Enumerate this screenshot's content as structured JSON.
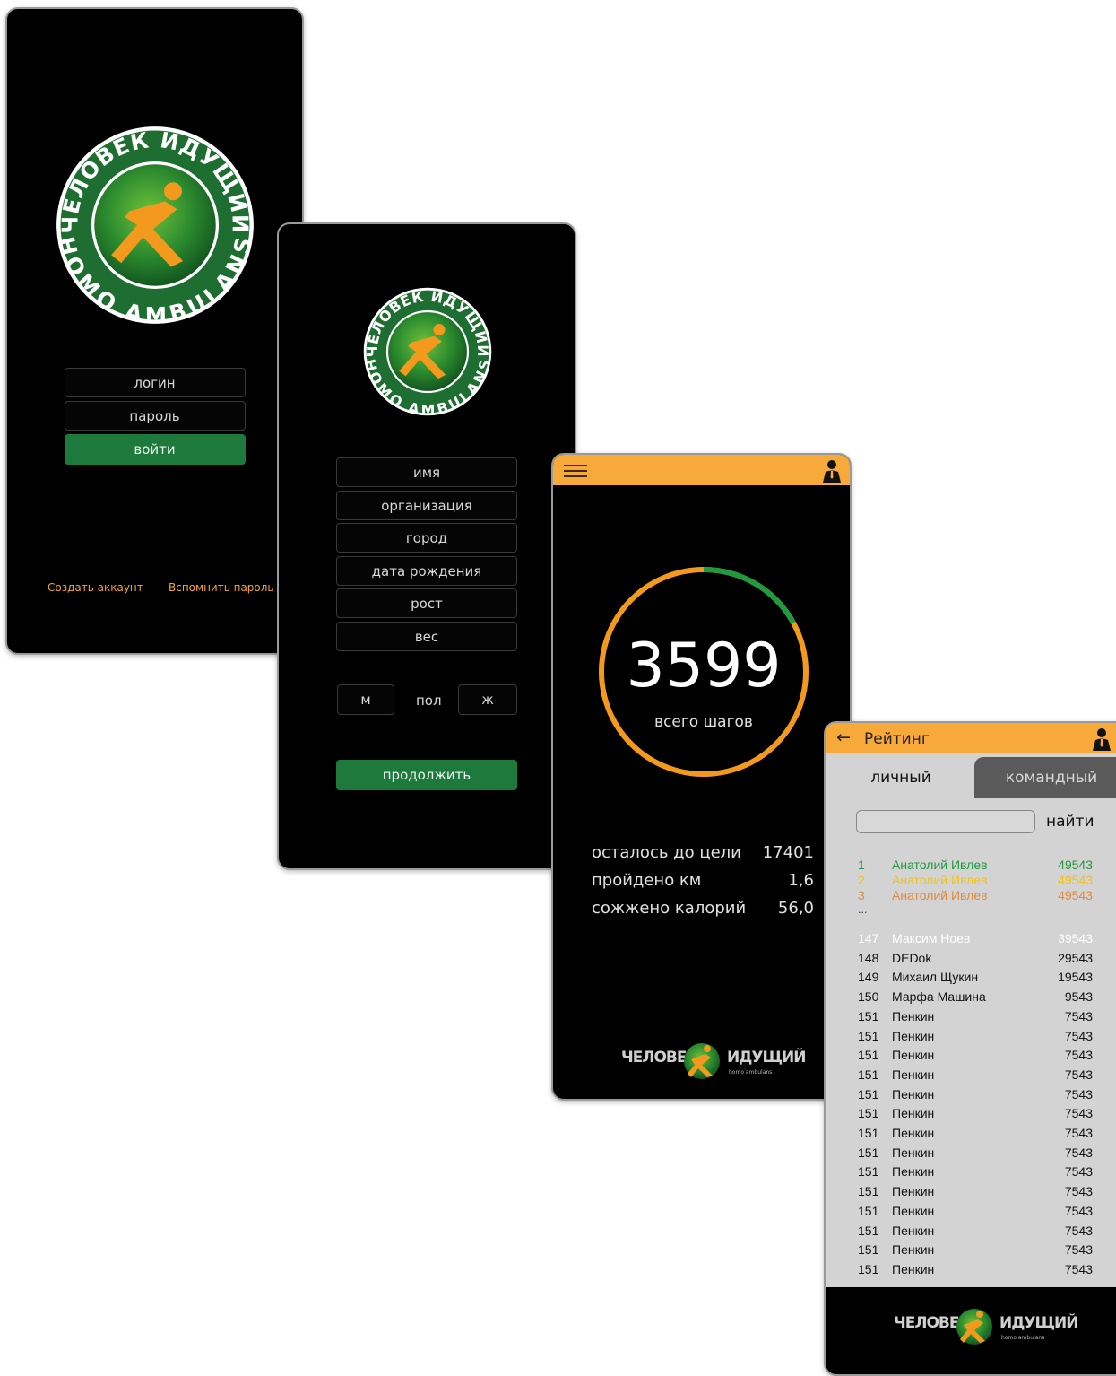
{
  "logo": {
    "top_text": "ЧЕЛОВЕК ИДУЩИЙ",
    "bottom_text": "HOMO AMBULANS",
    "wordmark_left": "ЧЕЛОВЕК",
    "wordmark_right": "ИДУЩИЙ",
    "wordmark_small": "homo ambulans"
  },
  "login": {
    "login_placeholder": "логин",
    "password_placeholder": "пароль",
    "submit_label": "войти",
    "create_account": "Создать аккаунт",
    "recover_password": "Вспомнить пароль"
  },
  "registration": {
    "fields": [
      "имя",
      "организация",
      "город",
      "дата рождения",
      "рост",
      "вес"
    ],
    "gender_male": "м",
    "gender_label": "пол",
    "gender_female": "ж",
    "continue_label": "продолжить"
  },
  "dashboard": {
    "steps": "3599",
    "steps_label": "всего шагов",
    "progress_fraction": 0.17,
    "stats": [
      {
        "label": "осталось до цели",
        "value": "17401"
      },
      {
        "label": "пройдено км",
        "value": "1,6"
      },
      {
        "label": "сожжено калорий",
        "value": "56,0"
      }
    ]
  },
  "rating": {
    "title": "Рейтинг",
    "back_icon": "arrow-left-icon",
    "tab_personal": "личный",
    "tab_team": "командный",
    "search_button": "найти",
    "ellipsis": "...",
    "top": [
      {
        "rank": "1",
        "name": "Анатолий Ивлев",
        "score": "49543",
        "color": "#1f9a3f"
      },
      {
        "rank": "2",
        "name": "Анатолий Ивлев",
        "score": "49543",
        "color": "#f2c21a"
      },
      {
        "rank": "3",
        "name": "Анатолий Ивлев",
        "score": "49543",
        "color": "#e08a3a"
      }
    ],
    "list": [
      {
        "rank": "147",
        "name": "Максим Ноев",
        "score": "39543",
        "color": "#ffffff"
      },
      {
        "rank": "148",
        "name": "DEDok",
        "score": "29543",
        "color": "#111111"
      },
      {
        "rank": "149",
        "name": "Михаил Щукин",
        "score": "19543",
        "color": "#111111"
      },
      {
        "rank": "150",
        "name": "Марфа Машина",
        "score": "9543",
        "color": "#111111"
      },
      {
        "rank": "151",
        "name": "Пенкин",
        "score": "7543",
        "color": "#111111"
      },
      {
        "rank": "151",
        "name": "Пенкин",
        "score": "7543",
        "color": "#111111"
      },
      {
        "rank": "151",
        "name": "Пенкин",
        "score": "7543",
        "color": "#111111"
      },
      {
        "rank": "151",
        "name": "Пенкин",
        "score": "7543",
        "color": "#111111"
      },
      {
        "rank": "151",
        "name": "Пенкин",
        "score": "7543",
        "color": "#111111"
      },
      {
        "rank": "151",
        "name": "Пенкин",
        "score": "7543",
        "color": "#111111"
      },
      {
        "rank": "151",
        "name": "Пенкин",
        "score": "7543",
        "color": "#111111"
      },
      {
        "rank": "151",
        "name": "Пенкин",
        "score": "7543",
        "color": "#111111"
      },
      {
        "rank": "151",
        "name": "Пенкин",
        "score": "7543",
        "color": "#111111"
      },
      {
        "rank": "151",
        "name": "Пенкин",
        "score": "7543",
        "color": "#111111"
      },
      {
        "rank": "151",
        "name": "Пенкин",
        "score": "7543",
        "color": "#111111"
      },
      {
        "rank": "151",
        "name": "Пенкин",
        "score": "7543",
        "color": "#111111"
      },
      {
        "rank": "151",
        "name": "Пенкин",
        "score": "7543",
        "color": "#111111"
      },
      {
        "rank": "151",
        "name": "Пенкин",
        "score": "7543",
        "color": "#111111"
      }
    ]
  },
  "colors": {
    "accent_orange": "#f7a939",
    "brand_green": "#1d7a3c",
    "progress_green": "#1f9a3f",
    "progress_orange": "#f39a1e"
  }
}
